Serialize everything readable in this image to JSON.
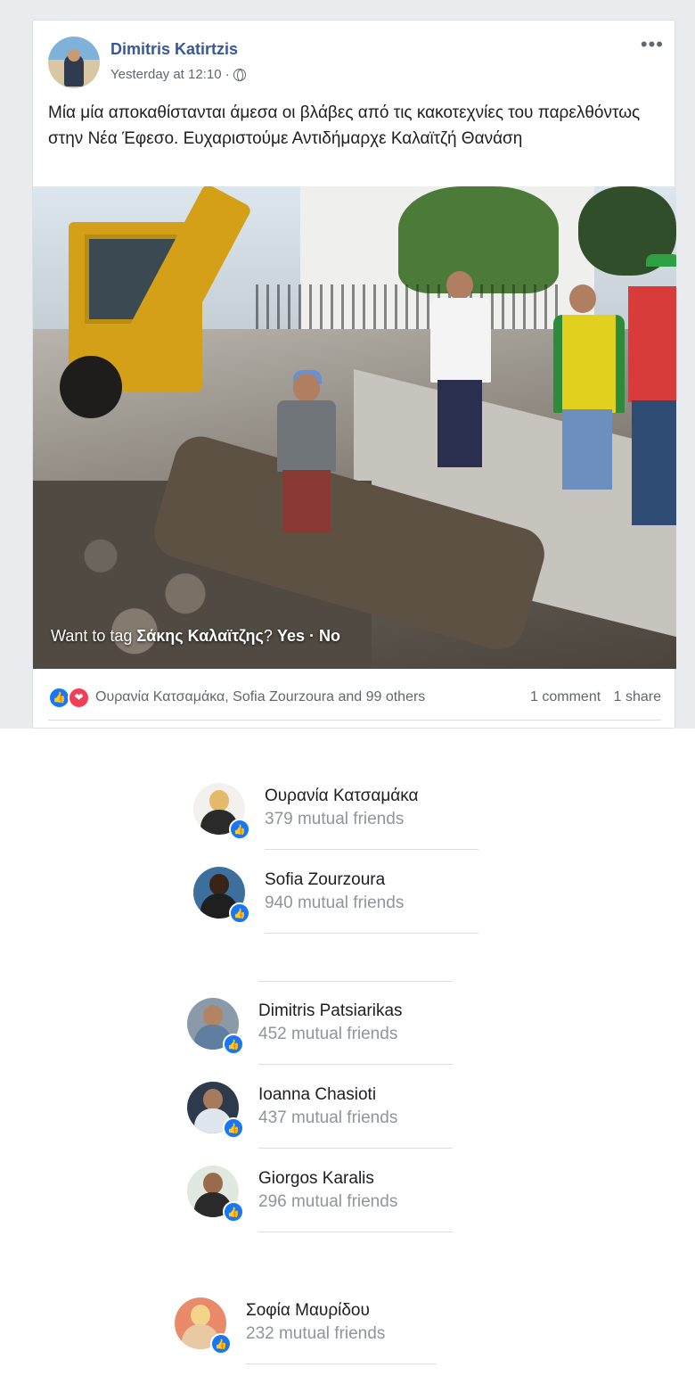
{
  "post": {
    "author": "Dimitris Katirtzis",
    "timestamp": "Yesterday at 12:10 ·",
    "more_label": "•••",
    "text": "Μία μία αποκαθίστανται άμεσα οι βλάβες από τις κακοτεχνίες του παρελθόντως στην Νέα Έφεσο. Ευχαριστούμε Αντιδήμαρχε Καλαϊτζή Θανάση",
    "tag_prompt": {
      "prefix": "Want to tag ",
      "name": "Σάκης Καλαϊτζης",
      "suffix": "?",
      "yes": "Yes",
      "dot": "·",
      "no": "No"
    },
    "reactions": {
      "reactors": "Ουρανία Κατσαμάκα, Sofia Zourzoura and 99 others",
      "comments": "1 comment",
      "shares": "1 share"
    },
    "colors": {
      "link": "#385898",
      "like": "#1877f2",
      "love": "#f33e58"
    }
  },
  "friends": [
    {
      "name": "Ουρανία Κατσαμάκα",
      "mutual": "379 mutual friends"
    },
    {
      "name": "Sofia Zourzoura",
      "mutual": "940 mutual friends"
    },
    {
      "name": "Dimitris Patsiarikas",
      "mutual": "452 mutual friends"
    },
    {
      "name": "Ioanna Chasioti",
      "mutual": "437 mutual friends"
    },
    {
      "name": "Giorgos Karalis",
      "mutual": "296 mutual friends"
    },
    {
      "name": "Σοφία Μαυρίδου",
      "mutual": "232 mutual friends"
    }
  ]
}
